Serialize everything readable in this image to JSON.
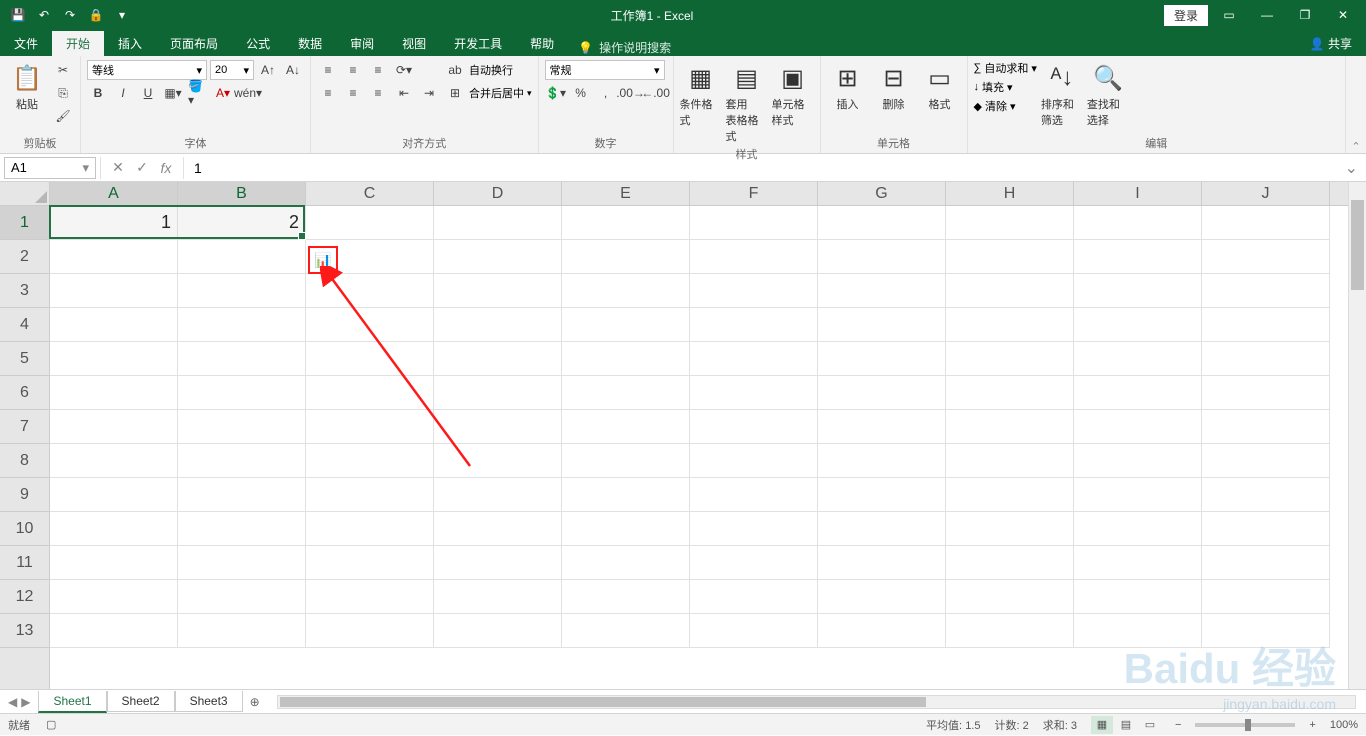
{
  "title": "工作簿1 - Excel",
  "qat": {
    "save": "💾",
    "undo": "↶",
    "redo": "↷",
    "touch": "🔒"
  },
  "login": "登录",
  "tabs": {
    "file": "文件",
    "home": "开始",
    "insert": "插入",
    "layout": "页面布局",
    "formulas": "公式",
    "data": "数据",
    "review": "审阅",
    "view": "视图",
    "devtools": "开发工具",
    "help": "帮助"
  },
  "tell_me": "操作说明搜索",
  "share": "共享",
  "ribbon": {
    "clipboard": {
      "label": "剪贴板",
      "paste": "粘贴"
    },
    "font": {
      "label": "字体",
      "name": "等线",
      "size": "20",
      "bold": "B",
      "italic": "I",
      "underline": "U"
    },
    "alignment": {
      "label": "对齐方式",
      "wrap": "自动换行",
      "merge": "合并后居中"
    },
    "number": {
      "label": "数字",
      "format": "常规"
    },
    "styles": {
      "label": "样式",
      "cond": "条件格式",
      "table": "套用\n表格格式",
      "cell": "单元格样式"
    },
    "cells": {
      "label": "单元格",
      "insert": "插入",
      "delete": "删除",
      "format": "格式"
    },
    "editing": {
      "label": "编辑",
      "sum": "自动求和",
      "fill": "填充",
      "clear": "清除",
      "sort": "排序和筛选",
      "find": "查找和选择"
    }
  },
  "name_box": "A1",
  "formula_value": "1",
  "columns": [
    "A",
    "B",
    "C",
    "D",
    "E",
    "F",
    "G",
    "H",
    "I",
    "J"
  ],
  "rows": [
    "1",
    "2",
    "3",
    "4",
    "5",
    "6",
    "7",
    "8",
    "9",
    "10",
    "11",
    "12",
    "13"
  ],
  "cells": {
    "A1": "1",
    "B1": "2"
  },
  "selection": {
    "start": "A1",
    "end": "B1"
  },
  "sheets": [
    "Sheet1",
    "Sheet2",
    "Sheet3"
  ],
  "active_sheet": 0,
  "status": {
    "ready": "就绪",
    "avg_label": "平均值:",
    "avg": "1.5",
    "count_label": "计数:",
    "count": "2",
    "sum_label": "求和:",
    "sum": "3",
    "zoom": "100%"
  },
  "watermark": {
    "main": "Baidu 经验",
    "sub": "jingyan.baidu.com"
  },
  "chart_data": {
    "type": "table",
    "columns": [
      "A",
      "B"
    ],
    "rows": [
      [
        1,
        2
      ]
    ]
  }
}
